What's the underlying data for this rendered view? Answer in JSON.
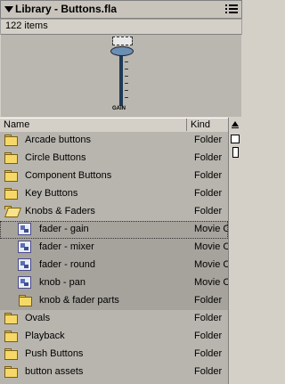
{
  "header": {
    "title": "Library - Buttons.fla"
  },
  "count": "122 items",
  "preview": {
    "label": "GAIN"
  },
  "columns": {
    "name": "Name",
    "kind": "Kind"
  },
  "rows": [
    {
      "name": "Arcade buttons",
      "kind": "Folder",
      "icon": "folder-icon"
    },
    {
      "name": "Circle Buttons",
      "kind": "Folder",
      "icon": "folder-icon"
    },
    {
      "name": "Component Buttons",
      "kind": "Folder",
      "icon": "folder-icon"
    },
    {
      "name": "Key Buttons",
      "kind": "Folder",
      "icon": "folder-icon"
    },
    {
      "name": "Knobs & Faders",
      "kind": "Folder",
      "icon": "open-folder-icon"
    },
    {
      "name": "fader - gain",
      "kind": "Movie Clip",
      "icon": "movie-clip-icon"
    },
    {
      "name": "fader - mixer",
      "kind": "Movie Clip",
      "icon": "movie-clip-icon"
    },
    {
      "name": "fader - round",
      "kind": "Movie Clip",
      "icon": "movie-clip-icon"
    },
    {
      "name": "knob - pan",
      "kind": "Movie Clip",
      "icon": "movie-clip-icon"
    },
    {
      "name": "knob & fader parts",
      "kind": "Folder",
      "icon": "folder-icon"
    },
    {
      "name": "Ovals",
      "kind": "Folder",
      "icon": "folder-icon"
    },
    {
      "name": "Playback",
      "kind": "Folder",
      "icon": "folder-icon"
    },
    {
      "name": "Push Buttons",
      "kind": "Folder",
      "icon": "folder-icon"
    },
    {
      "name": "button assets",
      "kind": "Folder",
      "icon": "folder-icon"
    }
  ]
}
